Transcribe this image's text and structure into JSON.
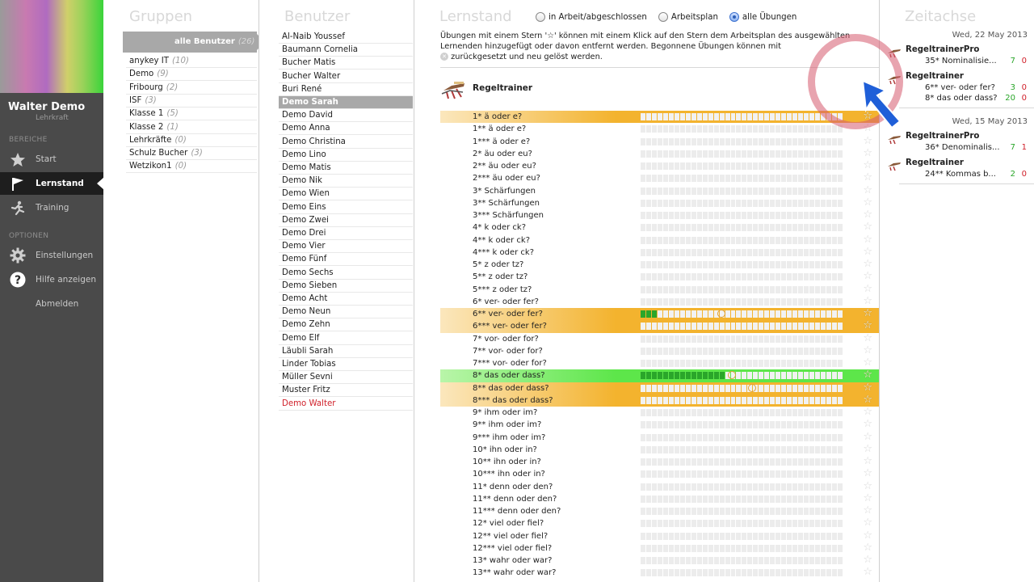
{
  "sidebar": {
    "user_name": "Walter Demo",
    "user_role": "Lehrkraft",
    "section_areas": "BEREICHE",
    "section_options": "OPTIONEN",
    "nav": [
      {
        "label": "Start",
        "icon": "star-icon"
      },
      {
        "label": "Lernstand",
        "icon": "flag-icon",
        "active": true
      },
      {
        "label": "Training",
        "icon": "runner-icon"
      }
    ],
    "options": [
      {
        "label": "Einstellungen",
        "icon": "gear-icon"
      },
      {
        "label": "Hilfe anzeigen",
        "icon": "help-icon"
      },
      {
        "label": "Abmelden"
      }
    ]
  },
  "groups": {
    "title": "Gruppen",
    "selected": {
      "label": "alle Benutzer",
      "count": "(26)"
    },
    "items": [
      {
        "label": "anykey IT",
        "count": "(10)"
      },
      {
        "label": "Demo",
        "count": "(9)"
      },
      {
        "label": "Fribourg",
        "count": "(2)"
      },
      {
        "label": "ISF",
        "count": "(3)"
      },
      {
        "label": "Klasse 1",
        "count": "(5)"
      },
      {
        "label": "Klasse 2",
        "count": "(1)"
      },
      {
        "label": "Lehrkräfte",
        "count": "(0)"
      },
      {
        "label": "Schulz Bucher",
        "count": "(3)"
      },
      {
        "label": "Wetzikon1",
        "count": "(0)"
      }
    ]
  },
  "users": {
    "title": "Benutzer",
    "items": [
      {
        "label": "Al-Naib Youssef"
      },
      {
        "label": "Baumann Cornelia"
      },
      {
        "label": "Bucher Matis"
      },
      {
        "label": "Bucher Walter"
      },
      {
        "label": "Buri René"
      },
      {
        "label": "Demo Sarah",
        "selected": true
      },
      {
        "label": "Demo David"
      },
      {
        "label": "Demo Anna"
      },
      {
        "label": "Demo Christina"
      },
      {
        "label": "Demo Lino"
      },
      {
        "label": "Demo Matis"
      },
      {
        "label": "Demo Nik"
      },
      {
        "label": "Demo Wien"
      },
      {
        "label": "Demo Eins"
      },
      {
        "label": "Demo Zwei"
      },
      {
        "label": "Demo Drei"
      },
      {
        "label": "Demo Vier"
      },
      {
        "label": "Demo Fünf"
      },
      {
        "label": "Demo Sechs"
      },
      {
        "label": "Demo Sieben"
      },
      {
        "label": "Demo Acht"
      },
      {
        "label": "Demo Neun"
      },
      {
        "label": "Demo Zehn"
      },
      {
        "label": "Demo Elf"
      },
      {
        "label": "Läubli Sarah"
      },
      {
        "label": "Linder Tobias"
      },
      {
        "label": "Müller Sevni"
      },
      {
        "label": "Muster Fritz"
      },
      {
        "label": "Demo Walter",
        "current": true
      }
    ]
  },
  "progress": {
    "title": "Lernstand",
    "filters": [
      {
        "label": "in Arbeit/abgeschlossen",
        "checked": false
      },
      {
        "label": "Arbeitsplan",
        "checked": false
      },
      {
        "label": "alle Übungen",
        "checked": true
      }
    ],
    "instructions_1": "Übungen mit einem Stern '☆' können mit einem Klick auf den Stern dem Arbeitsplan des ausgewählten Lernenden hinzugefügt oder davon entfernt werden. Begonnene Übungen können mit",
    "instructions_2": "zurückgesetzt und neu gelöst werden.",
    "trainer_name": "Regeltrainer",
    "collapse_icon": "chevron-down-icon",
    "exercises": [
      {
        "label": "1* ä oder e?",
        "highlight": "orange",
        "progress": 0
      },
      {
        "label": "1** ä oder e?",
        "progress": 0
      },
      {
        "label": "1*** ä oder e?",
        "progress": 0
      },
      {
        "label": "2* äu oder eu?",
        "progress": 0
      },
      {
        "label": "2** äu oder eu?",
        "progress": 0
      },
      {
        "label": "2*** äu oder eu?",
        "progress": 0
      },
      {
        "label": "3* Schärfungen",
        "progress": 0
      },
      {
        "label": "3** Schärfungen",
        "progress": 0
      },
      {
        "label": "3*** Schärfungen",
        "progress": 0
      },
      {
        "label": "4* k oder ck?",
        "progress": 0
      },
      {
        "label": "4** k oder ck?",
        "progress": 0
      },
      {
        "label": "4*** k oder ck?",
        "progress": 0
      },
      {
        "label": "5* z oder tz?",
        "progress": 0
      },
      {
        "label": "5** z oder tz?",
        "progress": 0
      },
      {
        "label": "5*** z oder tz?",
        "progress": 0
      },
      {
        "label": "6* ver- oder fer?",
        "progress": 0
      },
      {
        "label": "6** ver- oder fer?",
        "highlight": "orange",
        "progress": 0.08,
        "marker": 0.38
      },
      {
        "label": "6*** ver- oder fer?",
        "highlight": "orange",
        "progress": 0
      },
      {
        "label": "7* vor- oder for?",
        "progress": 0
      },
      {
        "label": "7** vor- oder for?",
        "progress": 0
      },
      {
        "label": "7*** vor- oder for?",
        "progress": 0
      },
      {
        "label": "8* das oder dass?",
        "highlight": "green",
        "progress": 0.41,
        "marker": 0.43
      },
      {
        "label": "8** das oder dass?",
        "highlight": "orange",
        "progress": 0,
        "marker": 0.53
      },
      {
        "label": "8*** das oder dass?",
        "highlight": "orange",
        "progress": 0
      },
      {
        "label": "9* ihm oder im?",
        "progress": 0
      },
      {
        "label": "9** ihm oder im?",
        "progress": 0
      },
      {
        "label": "9*** ihm oder im?",
        "progress": 0
      },
      {
        "label": "10* ihn oder in?",
        "progress": 0
      },
      {
        "label": "10** ihn oder in?",
        "progress": 0
      },
      {
        "label": "10*** ihn oder in?",
        "progress": 0
      },
      {
        "label": "11* denn oder den?",
        "progress": 0
      },
      {
        "label": "11** denn oder den?",
        "progress": 0
      },
      {
        "label": "11*** denn oder den?",
        "progress": 0
      },
      {
        "label": "12* viel oder fiel?",
        "progress": 0
      },
      {
        "label": "12** viel oder fiel?",
        "progress": 0
      },
      {
        "label": "12*** viel oder fiel?",
        "progress": 0
      },
      {
        "label": "13* wahr oder war?",
        "progress": 0
      },
      {
        "label": "13** wahr oder war?",
        "progress": 0
      }
    ]
  },
  "timeline": {
    "title": "Zeitachse",
    "days": [
      {
        "date": "Wed, 22 May 2013",
        "entries": [
          {
            "name": "RegeltrainerPro",
            "lines": [
              {
                "text": "35* Nominalisie...",
                "ok": "7",
                "err": "0"
              }
            ]
          },
          {
            "name": "Regeltrainer",
            "lines": [
              {
                "text": "6** ver- oder fer?",
                "ok": "3",
                "err": "0"
              },
              {
                "text": "8* das oder dass?",
                "ok": "20",
                "err": "0"
              }
            ]
          }
        ]
      },
      {
        "date": "Wed, 15 May 2013",
        "entries": [
          {
            "name": "RegeltrainerPro",
            "lines": [
              {
                "text": "36* Denominalis...",
                "ok": "7",
                "err": "1"
              }
            ]
          },
          {
            "name": "Regeltrainer",
            "lines": [
              {
                "text": "24** Kommas b...",
                "ok": "2",
                "err": "0"
              }
            ]
          }
        ]
      }
    ]
  },
  "colors": {
    "accent_orange": "#f3b32e",
    "accent_green": "#5de64a",
    "progress_green": "#2aa62a",
    "current_user_red": "#d0202a",
    "ring_pink": "#d65a6e",
    "arrow_blue": "#1f5fd8"
  }
}
